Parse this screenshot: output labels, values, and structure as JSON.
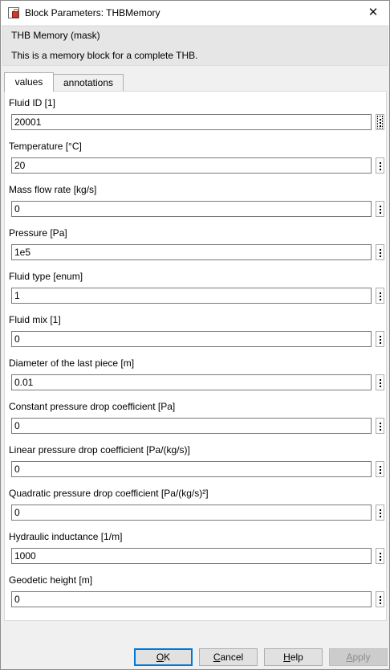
{
  "window": {
    "title": "Block Parameters: THBMemory",
    "close_glyph": "✕"
  },
  "mask": {
    "title": "THB Memory (mask)",
    "description": "This is a memory block for a complete THB."
  },
  "tabs": [
    {
      "label": "values"
    },
    {
      "label": "annotations"
    }
  ],
  "params": [
    {
      "label": "Fluid ID [1]",
      "value": "20001"
    },
    {
      "label": "Temperature [°C]",
      "value": "20"
    },
    {
      "label": "Mass flow rate [kg/s]",
      "value": "0"
    },
    {
      "label": "Pressure [Pa]",
      "value": "1e5"
    },
    {
      "label": "Fluid type [enum]",
      "value": "1"
    },
    {
      "label": "Fluid mix [1]",
      "value": "0"
    },
    {
      "label": "Diameter of the last piece [m]",
      "value": "0.01"
    },
    {
      "label": "Constant pressure drop coefficient [Pa]",
      "value": "0"
    },
    {
      "label": "Linear pressure drop coefficient [Pa/(kg/s)]",
      "value": "0"
    },
    {
      "label": "Quadratic pressure drop coefficient [Pa/(kg/s)²]",
      "value": "0"
    },
    {
      "label": "Hydraulic inductance [1/m]",
      "value": "1000"
    },
    {
      "label": "Geodetic height [m]",
      "value": "0"
    }
  ],
  "buttons": {
    "ok": {
      "first": "O",
      "rest": "K"
    },
    "cancel": {
      "first": "C",
      "rest": "ancel"
    },
    "help": {
      "first": "H",
      "rest": "elp"
    },
    "apply": {
      "first": "A",
      "rest": "pply"
    }
  },
  "colors": {
    "accent": "#0078d7",
    "icon_red": "#d23a2e"
  }
}
